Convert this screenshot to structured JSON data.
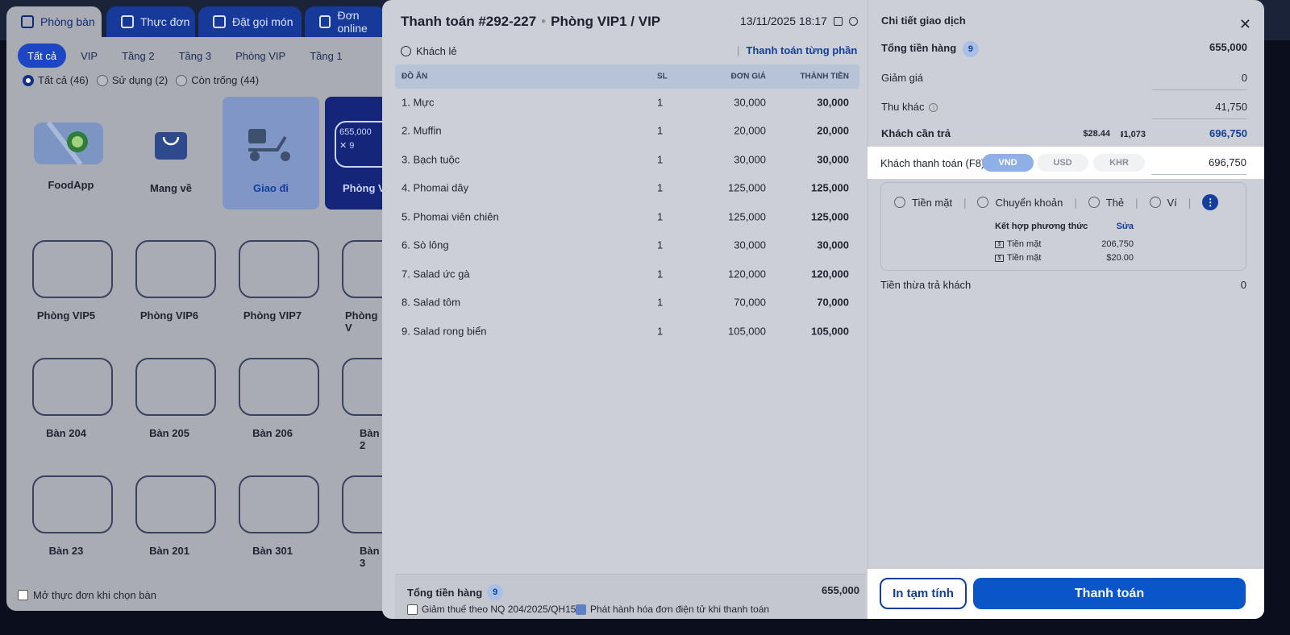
{
  "app": {
    "tabs": [
      {
        "label": "Phòng bàn",
        "icon": "table-icon"
      },
      {
        "label": "Thực đơn",
        "icon": "menu-icon"
      },
      {
        "label": "Đặt gọi món",
        "icon": "order-icon"
      },
      {
        "label": "Đơn online",
        "icon": "bag-icon"
      }
    ],
    "filters": [
      "Tất cả",
      "VIP",
      "Tầng 2",
      "Tầng 3",
      "Phòng VIP",
      "Tầng 1"
    ],
    "status": [
      "Tất cả (46)",
      "Sử dụng (2)",
      "Còn trống (44)"
    ],
    "quick_cards": [
      {
        "label": "FoodApp"
      },
      {
        "label": "Mang về"
      },
      {
        "label": "Giao đi"
      },
      {
        "label": "Phòng V",
        "amount": "655,000",
        "count": "9"
      }
    ],
    "tables_row1": [
      "Phòng VIP5",
      "Phòng VIP6",
      "Phòng VIP7",
      "Phòng V"
    ],
    "tables_row2": [
      "Bàn 204",
      "Bàn 205",
      "Bàn 206",
      "Bàn 2"
    ],
    "tables_row3": [
      "Bàn 23",
      "Bàn 201",
      "Bàn 301",
      "Bàn 3"
    ],
    "open_menu_label": "Mở thực đơn khi chọn bàn"
  },
  "modal": {
    "title": "Thanh toán #292-227",
    "room": "Phòng VIP1 / VIP",
    "datetime": "13/11/2025 18:17",
    "customer": "Khách lẻ",
    "split_pay": "Thanh toán từng phần",
    "columns": {
      "item": "ĐỒ ĂN",
      "qty": "SL",
      "price": "ĐƠN GIÁ",
      "total": "THÀNH TIỀN"
    },
    "items": [
      {
        "name": "1. Mực",
        "qty": "1",
        "price": "30,000",
        "total": "30,000"
      },
      {
        "name": "2. Muffin",
        "qty": "1",
        "price": "20,000",
        "total": "20,000"
      },
      {
        "name": "3. Bạch tuộc",
        "qty": "1",
        "price": "30,000",
        "total": "30,000"
      },
      {
        "name": "4. Phomai dây",
        "qty": "1",
        "price": "125,000",
        "total": "125,000"
      },
      {
        "name": "5. Phomai viên chiên",
        "qty": "1",
        "price": "125,000",
        "total": "125,000"
      },
      {
        "name": "6. Sò lông",
        "qty": "1",
        "price": "30,000",
        "total": "30,000"
      },
      {
        "name": "7. Salad ức gà",
        "qty": "1",
        "price": "120,000",
        "total": "120,000"
      },
      {
        "name": "8. Salad tôm",
        "qty": "1",
        "price": "70,000",
        "total": "70,000"
      },
      {
        "name": "9. Salad rong biển",
        "qty": "1",
        "price": "105,000",
        "total": "105,000"
      }
    ],
    "footer": {
      "total_label": "Tổng tiền hàng",
      "total_count": "9",
      "total_value": "655,000",
      "tax_label": "Giảm thuế theo NQ 204/2025/QH15",
      "einvoice_label": "Phát hành hóa đơn điện tử khi thanh toán"
    },
    "detail": {
      "title": "Chi tiết giao dịch",
      "goods_label": "Tổng tiền hàng",
      "goods_count": "9",
      "goods_value": "655,000",
      "discount_label": "Giảm giá",
      "discount_value": "0",
      "other_label": "Thu khác",
      "other_value": "41,750",
      "due_label": "Khách cần trả",
      "due_usd": "$28.44",
      "due_khr": "៛1,073",
      "due_value": "696,750",
      "paid_label": "Khách thanh toán (F8)",
      "currencies": [
        "VND",
        "USD",
        "KHR"
      ],
      "paid_value": "696,750",
      "methods": [
        "Tiền mặt",
        "Chuyển khoản",
        "Thẻ",
        "Ví"
      ],
      "combo_title": "Kết hợp phương thức",
      "combo_edit": "Sửa",
      "combo_lines": [
        {
          "name": "Tiền mặt",
          "amount": "206,750"
        },
        {
          "name": "Tiền mặt",
          "amount": "$20.00"
        }
      ],
      "change_label": "Tiền thừa trả khách",
      "change_value": "0"
    },
    "buttons": {
      "print": "In tạm tính",
      "pay": "Thanh toán"
    }
  }
}
